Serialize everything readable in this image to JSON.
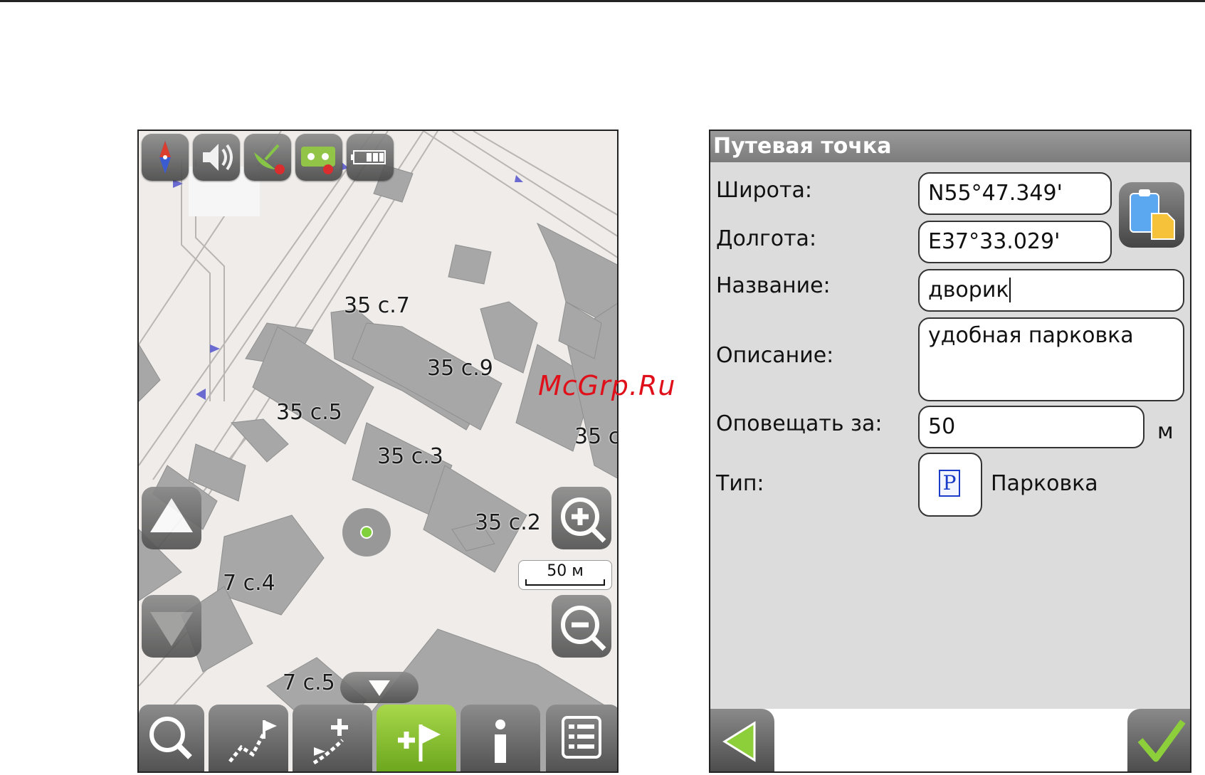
{
  "map": {
    "buildings": [
      {
        "label": "35 с.7"
      },
      {
        "label": "35 с.9"
      },
      {
        "label": "35 с.5"
      },
      {
        "label": "35 с.3"
      },
      {
        "label": "35 с"
      },
      {
        "label": "35 с.2"
      },
      {
        "label": "7 с.4"
      },
      {
        "label": "7 с.5"
      }
    ],
    "scale_label": "50 м",
    "toolbar_icons": [
      "compass-icon",
      "speaker-icon",
      "gps-satellite-icon",
      "track-recorder-icon",
      "battery-icon"
    ],
    "bottom_buttons": [
      "search-icon",
      "route-icon",
      "add-route-point-icon",
      "add-waypoint-icon",
      "info-icon",
      "menu-list-icon"
    ],
    "colors": {
      "building": "#a7a7a7",
      "ground": "#efece9",
      "active_button": "#7fbf2a",
      "road_arrow": "#6a6ad0"
    }
  },
  "form": {
    "title": "Путевая точка",
    "latitude_label": "Широта:",
    "latitude_value": "N55°47.349'",
    "longitude_label": "Долгота:",
    "longitude_value": "E37°33.029'",
    "name_label": "Название:",
    "name_value": "дворик",
    "description_label": "Описание:",
    "description_value": "удобная парковка",
    "notify_label": "Оповещать за:",
    "notify_value": "50",
    "notify_unit": "м",
    "type_label": "Тип:",
    "type_icon_letter": "P",
    "type_value": "Парковка"
  },
  "watermark": "McGrp.Ru"
}
